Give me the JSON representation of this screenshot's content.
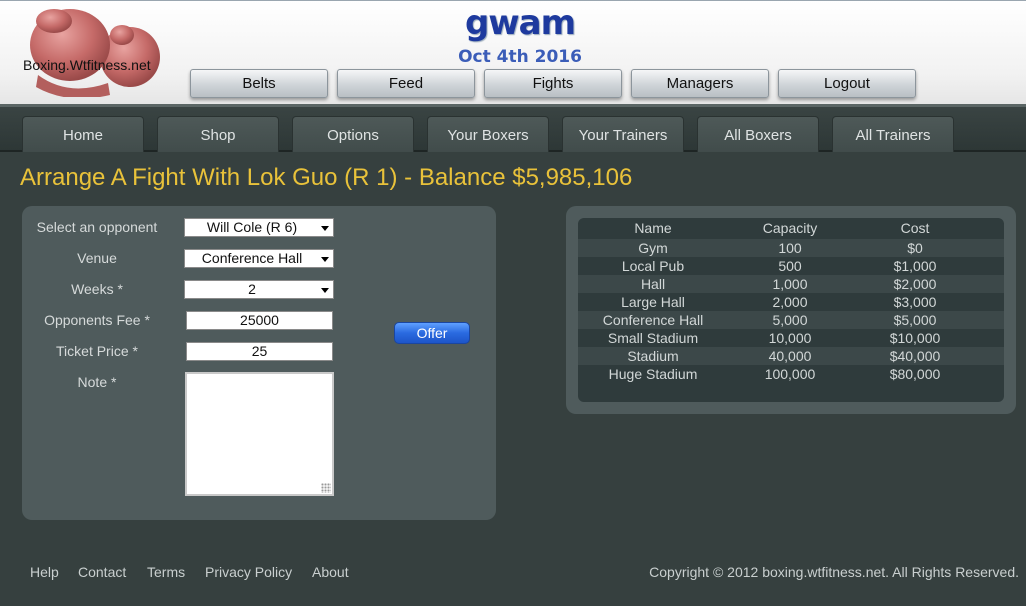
{
  "site": {
    "logo_text": "Boxing.Wtfitness.net",
    "title": "gwam",
    "date": "Oct 4th 2016"
  },
  "top_nav": [
    "Belts",
    "Feed",
    "Fights",
    "Managers",
    "Logout"
  ],
  "main_nav": [
    "Home",
    "Shop",
    "Options",
    "Your Boxers",
    "Your Trainers",
    "All Boxers",
    "All Trainers"
  ],
  "heading": "Arrange A Fight With Lok Guo (R 1) - Balance $5,985,106",
  "form": {
    "opponent_label": "Select an opponent",
    "opponent_value": "Will Cole (R 6)",
    "venue_label": "Venue",
    "venue_value": "Conference Hall",
    "weeks_label": "Weeks *",
    "weeks_value": "2",
    "fee_label": "Opponents Fee *",
    "fee_value": "25000",
    "ticket_label": "Ticket Price *",
    "ticket_value": "25",
    "note_label": "Note *",
    "offer_label": "Offer"
  },
  "venues": {
    "headers": [
      "Name",
      "Capacity",
      "Cost"
    ],
    "rows": [
      [
        "Gym",
        "100",
        "$0"
      ],
      [
        "Local Pub",
        "500",
        "$1,000"
      ],
      [
        "Hall",
        "1,000",
        "$2,000"
      ],
      [
        "Large Hall",
        "2,000",
        "$3,000"
      ],
      [
        "Conference Hall",
        "5,000",
        "$5,000"
      ],
      [
        "Small Stadium",
        "10,000",
        "$10,000"
      ],
      [
        "Stadium",
        "40,000",
        "$40,000"
      ],
      [
        "Huge Stadium",
        "100,000",
        "$80,000"
      ]
    ]
  },
  "footer": {
    "links": [
      "Help",
      "Contact",
      "Terms",
      "Privacy Policy",
      "About"
    ],
    "copyright": "Copyright © 2012 boxing.wtfitness.net. All Rights Reserved."
  },
  "colors": {
    "heading": "#e9c23a",
    "title": "#1e3a9e",
    "offer_button": "#2a6ae0"
  }
}
